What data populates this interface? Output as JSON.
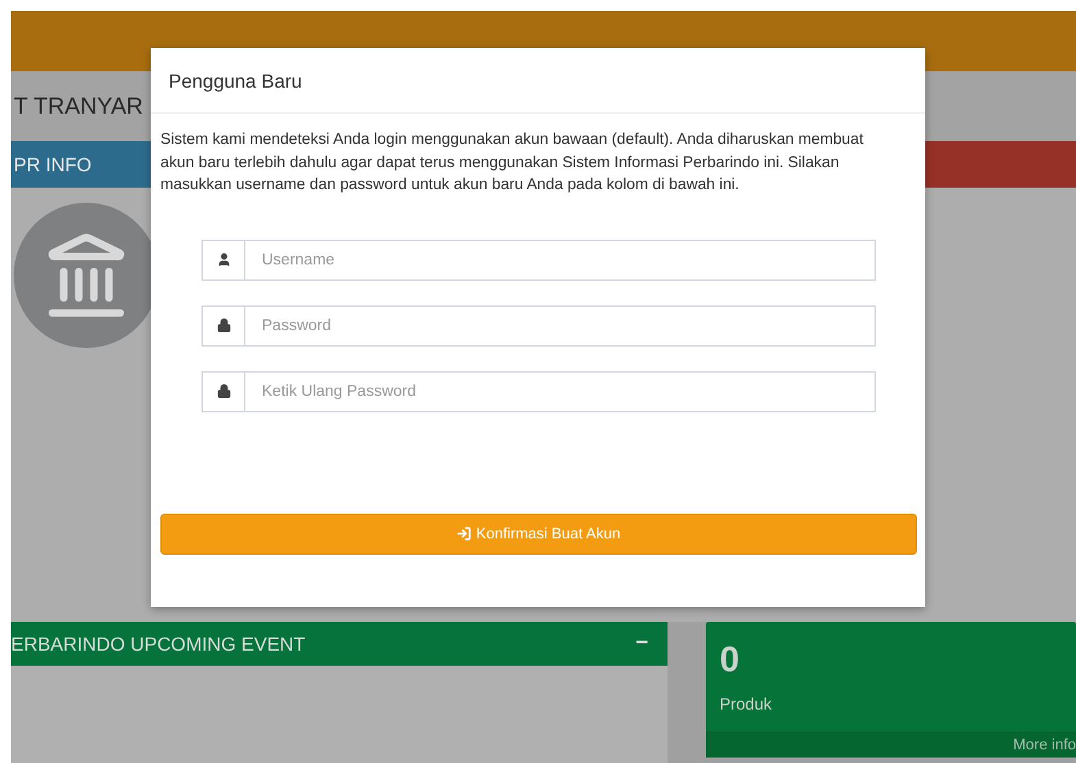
{
  "page": {
    "title": "T TRANYAR",
    "info_box": {
      "label": "PR INFO"
    }
  },
  "events_panel": {
    "title": "ERBARINDO UPCOMING EVENT",
    "collapse_symbol": "−"
  },
  "stat_card": {
    "value": "0",
    "label": "Produk",
    "link": "More info"
  },
  "modal": {
    "title": "Pengguna Baru",
    "message": "Sistem kami mendeteksi Anda login menggunakan akun bawaan (default). Anda diharuskan membuat akun baru terlebih dahulu agar dapat terus menggunakan Sistem Informasi Perbarindo ini. Silakan masukkan username dan password untuk akun baru Anda pada kolom di bawah ini.",
    "fields": [
      {
        "kind": "user",
        "placeholder": "Username"
      },
      {
        "kind": "lock",
        "placeholder": "Password"
      },
      {
        "kind": "lock",
        "placeholder": "Ketik Ulang Password"
      }
    ],
    "submit": "Konfirmasi Buat Akun"
  }
}
